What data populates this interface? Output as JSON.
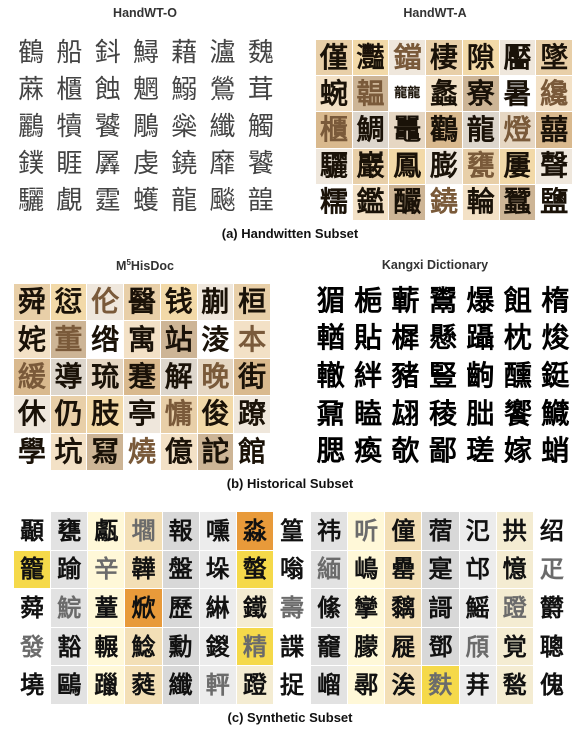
{
  "panel_a": {
    "left_title": "HandWT-O",
    "right_title": "HandWT-A",
    "caption": "(a) Handwitten Subset",
    "left_rows": [
      [
        "鶴",
        "船",
        "鈄",
        "鱘",
        "藉",
        "瀘",
        "魏"
      ],
      [
        "蔴",
        "櫃",
        "蝕",
        "魍",
        "鰯",
        "鶯",
        "茸"
      ],
      [
        "鸝",
        "犢",
        "饕",
        "鵰",
        "橤",
        "纖",
        "觸"
      ],
      [
        "鏷",
        "睚",
        "羼",
        "虔",
        "鐃",
        "靡",
        "饕"
      ],
      [
        "驪",
        "覰",
        "霆",
        "蠖",
        "龍",
        "飈",
        "韹"
      ]
    ],
    "right_rows": [
      [
        "僅",
        "灩",
        "鐺",
        "棲",
        "隙",
        "靨",
        "墜"
      ],
      [
        "蜿",
        "韞",
        "龍龍",
        "蠡",
        "寮",
        "暑",
        "纔"
      ],
      [
        "櫃",
        "鯛",
        "鼉",
        "鸛",
        "龍",
        "燈",
        "囍"
      ],
      [
        "驪",
        "巖",
        "鳳",
        "膨",
        "甕",
        "屢",
        "聲"
      ],
      [
        "糯",
        "鑑",
        "釅",
        "鐃",
        "輪",
        "蠶",
        "鹽"
      ]
    ]
  },
  "panel_b": {
    "left_title_pre": "M",
    "left_title_sup": "5",
    "left_title_post": "HisDoc",
    "right_title": "Kangxi Dictionary",
    "caption": "(b) Historical Subset",
    "left_rows": [
      [
        "舜",
        "愆",
        "伦",
        "醫",
        "钱",
        "蒯",
        "桓"
      ],
      [
        "姹",
        "董",
        "绺",
        "寓",
        "站",
        "淩",
        "本"
      ],
      [
        "緩",
        "導",
        "琉",
        "蹇",
        "解",
        "晚",
        "街"
      ],
      [
        "休",
        "仍",
        "肢",
        "亭",
        "慵",
        "俊",
        "蹽"
      ],
      [
        "學",
        "坑",
        "冩",
        "燒",
        "億",
        "詑",
        "館"
      ]
    ],
    "right_rows": [
      [
        "猸",
        "梔",
        "蘄",
        "鬻",
        "爆",
        "飷",
        "楕"
      ],
      [
        "輶",
        "貼",
        "樨",
        "懸",
        "躡",
        "枕",
        "焌"
      ],
      [
        "轍",
        "絆",
        "豬",
        "豎",
        "齣",
        "醺",
        "鋌"
      ],
      [
        "鼐",
        "瞌",
        "翃",
        "稜",
        "朏",
        "饗",
        "鱵"
      ],
      [
        "腮",
        "瘓",
        "欹",
        "鄙",
        "瑳",
        "嫁",
        "蛸"
      ]
    ]
  },
  "panel_c": {
    "caption": "(c) Synthetic Subset",
    "rows": [
      [
        "顳",
        "甕",
        "甗",
        "壛",
        "報",
        "嚑",
        "淼",
        "篁",
        "祎",
        "听",
        "僮",
        "蓿",
        "氾",
        "拱",
        "绍"
      ],
      [
        "籠",
        "踰",
        "辛",
        "韡",
        "盤",
        "垛",
        "螫",
        "嗡",
        "緬",
        "嶋",
        "罍",
        "寔",
        "邙",
        "憶",
        "疋"
      ],
      [
        "蕣",
        "鯇",
        "蕫",
        "焮",
        "歷",
        "綝",
        "鐵",
        "壽",
        "絛",
        "攣",
        "黐",
        "謌",
        "鰩",
        "蹬",
        "欝"
      ],
      [
        "發",
        "豁",
        "輾",
        "鯰",
        "勳",
        "鍐",
        "精",
        "諜",
        "竉",
        "朦",
        "屣",
        "鄧",
        "頎",
        "覚",
        "聰"
      ],
      [
        "墝",
        "鷗",
        "躐",
        "蕤",
        "纖",
        "軯",
        "蹬",
        "捉",
        "嵧",
        "鄩",
        "涘",
        "麩",
        "荓",
        "甃",
        "傀"
      ]
    ]
  },
  "colors": {
    "hw_ink": "#444444",
    "scan_bg": [
      "#e8cfa8",
      "#f3e1c6",
      "#d9b98e",
      "#efe7dc",
      "#ffffff",
      "#e6d7c3",
      "#f2d9a8",
      "#cdb596",
      "#ddd6cc"
    ],
    "syn_bg": [
      "#ffffff",
      "#ececec",
      "#f3dfb6",
      "#e2e2e2",
      "#f4ecd2",
      "#d8d8d8",
      "#fff8d8"
    ],
    "highlight_yellow": "#f5d94a",
    "highlight_orange": "#e89a3a"
  }
}
